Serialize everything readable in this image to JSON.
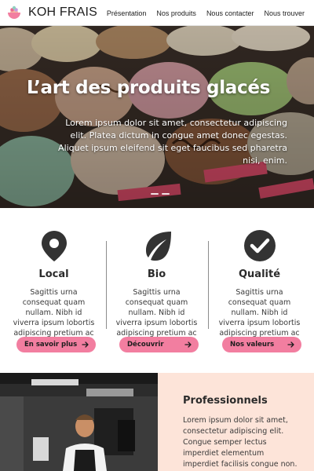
{
  "header": {
    "brand": "KOH FRAIS",
    "nav": [
      "Présentation",
      "Nos produits",
      "Nous contacter",
      "Nous trouver"
    ]
  },
  "hero": {
    "title": "L’art des produits glacés",
    "text": "Lorem ipsum dolor sit amet, consectetur adipiscing elit. Platea dictum in congue amet donec egestas. Aliquet ipsum eleifend sit eget faucibus sed pharetra nisi, enim."
  },
  "features": [
    {
      "icon": "location-pin-icon",
      "title": "Local",
      "text": "Sagittis urna consequat quam nullam. Nibh id viverra ipsum lobortis adipiscing pretium ac velit.",
      "button": "En savoir plus"
    },
    {
      "icon": "leaf-icon",
      "title": "Bio",
      "text": "Sagittis urna consequat quam nullam. Nibh id viverra ipsum lobortis adipiscing pretium ac velit.",
      "button": "Découvrir"
    },
    {
      "icon": "checkmark-circle-icon",
      "title": "Qualité",
      "text": "Sagittis urna consequat quam nullam. Nibh id viverra ipsum lobortis adipiscing pretium ac velit.",
      "button": "Nos valeurs"
    }
  ],
  "professionals": {
    "title": "Professionnels",
    "text": "Lorem ipsum dolor sit amet, consectetur adipiscing elit. Congue semper lectus imperdiet elementum imperdiet facilisis congue non. Sit"
  },
  "colors": {
    "accent_pink": "#f27ea0",
    "panel_peach": "#fde4d9",
    "icon_dark": "#333333"
  }
}
